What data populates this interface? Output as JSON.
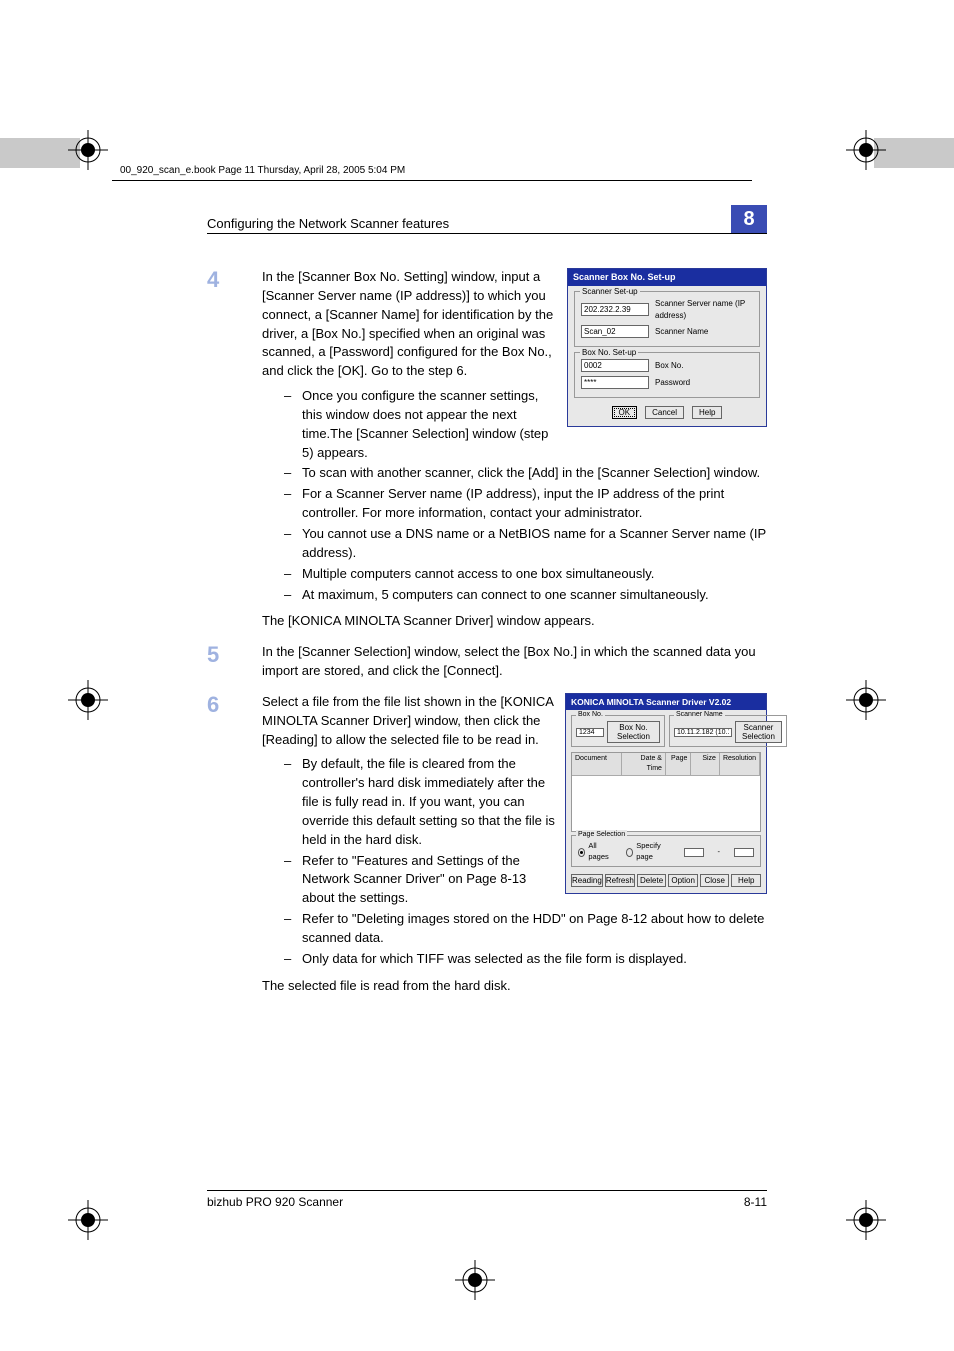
{
  "headerline": "00_920_scan_e.book  Page 11  Thursday, April 28, 2005  5:04 PM",
  "running_head": "Configuring the Network Scanner features",
  "chapter_no": "8",
  "steps": {
    "s4": {
      "num": "4",
      "para": "In the [Scanner Box No. Setting] window, input a [Scanner Server name (IP address)] to which you connect, a [Scanner Name] for identification by the driver, a [Box No.] specified when an original was scanned, a [Password] configured for the Box No., and click the [OK]. Go to the step 6.",
      "bullets": [
        "Once you configure the scanner settings, this window does not appear the next time.The [Scanner Selection] window (step 5) appears.",
        "To scan with another scanner, click the [Add] in the [Scanner Selection] window.",
        "For a Scanner Server name (IP address), input the IP address of the print controller. For more information, contact your administrator.",
        "You cannot use a DNS name or a NetBIOS name for a Scanner Server name (IP address).",
        "Multiple computers cannot access to one box simultaneously.",
        "At maximum, 5 computers can connect to one scanner simultaneously."
      ],
      "after": "The [KONICA MINOLTA Scanner Driver] window appears."
    },
    "s5": {
      "num": "5",
      "para": "In the [Scanner Selection] window, select the [Box No.] in which the scanned data you import are stored, and click the [Connect]."
    },
    "s6": {
      "num": "6",
      "para": "Select a file from the file list shown in the [KONICA MINOLTA Scanner Driver] window, then click the [Reading] to allow the selected file to be read in.",
      "bullets": [
        "By default, the file is cleared from the controller's hard disk immediately after the file is fully read in. If you want, you can override this default setting so that the file is held in the hard disk.",
        "Refer to \"Features and Settings of the Network Scanner Driver\" on Page 8-13 about the settings.",
        "Refer to \"Deleting images stored on the HDD\" on Page 8-12 about how to delete scanned data.",
        "Only data for which TIFF was selected as the file form is displayed."
      ],
      "after": "The selected file is read from the hard disk."
    }
  },
  "dlg1": {
    "title": "Scanner Box No. Set-up",
    "grp1_legend": "Scanner Set-up",
    "server_ip": "202.232.2.39",
    "server_ip_label": "Scanner Server name (IP address)",
    "scanner_name": "Scan_02",
    "scanner_name_label": "Scanner Name",
    "grp2_legend": "Box No. Set-up",
    "box_no": "0002",
    "box_no_label": "Box No.",
    "password": "****",
    "password_label": "Password",
    "ok": "OK",
    "cancel": "Cancel",
    "help": "Help"
  },
  "dlg2": {
    "title": "KONICA MINOLTA Scanner Driver V2.02",
    "boxno_legend": "Box No.",
    "boxno_value": "1234",
    "boxno_btn": "Box No. Selection",
    "scanner_legend": "Scanner Name",
    "scanner_value": "10.11.2.182 (10.11.",
    "scanner_btn": "Scanner Selection",
    "thead": [
      "Document",
      "Date & Time",
      "Page",
      "Size",
      "Resolution"
    ],
    "pagesel_legend": "Page Selection",
    "radio_all": "All pages",
    "radio_specify": "Specify page",
    "range_sep": "-",
    "buttons": [
      "Reading",
      "Refresh",
      "Delete",
      "Option",
      "Close",
      "Help"
    ]
  },
  "footer": {
    "left": "bizhub PRO 920 Scanner",
    "right": "8-11"
  }
}
